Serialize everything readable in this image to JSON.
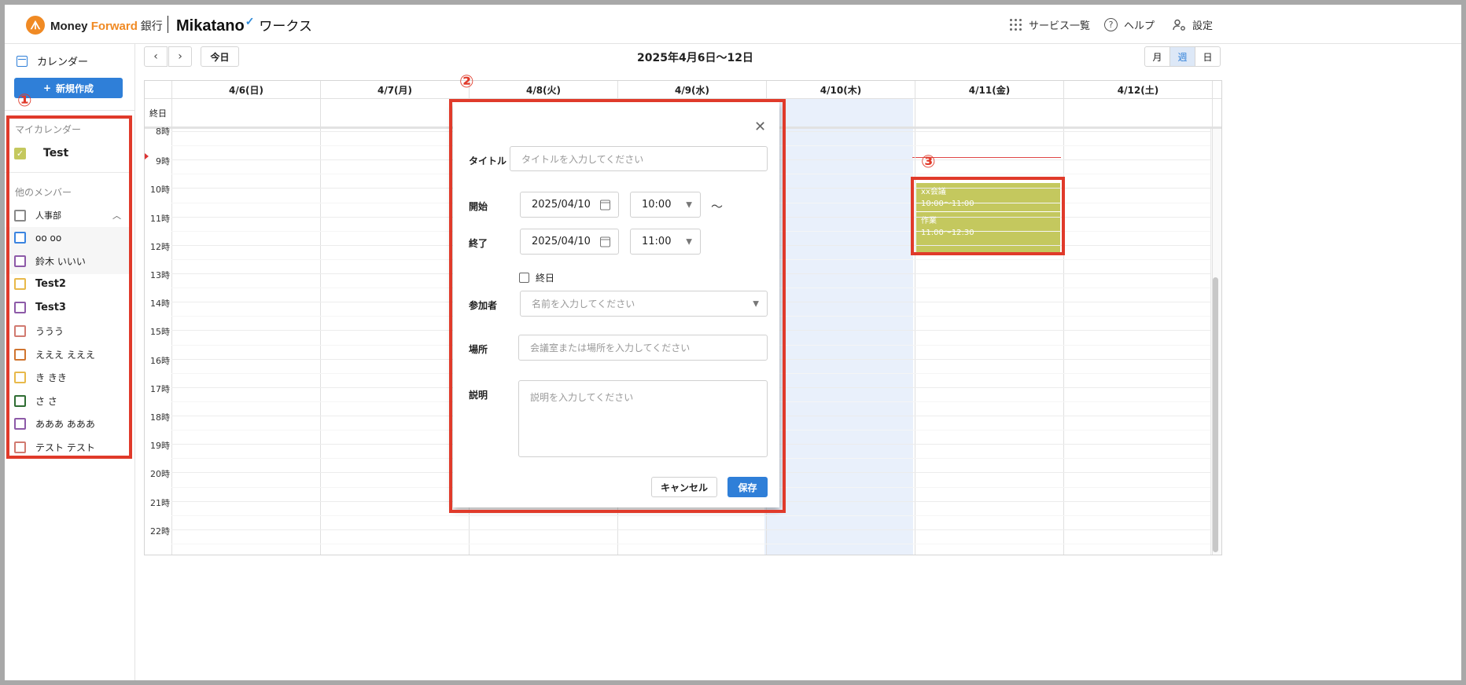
{
  "header": {
    "brand_money": "Money ",
    "brand_forward": "Forward",
    "brand_bank": " 銀行",
    "product": "Mikatano",
    "product_sub": "ワークス",
    "services_label": "サービス一覧",
    "help_label": "ヘルプ",
    "settings_label": "設定"
  },
  "sidebar": {
    "calendar_label": "カレンダー",
    "new_button": "新規作成",
    "my_calendars_title": "マイカレンダー",
    "my_calendars": [
      {
        "label": "Test",
        "color": "#c4c85e",
        "checked": true
      }
    ],
    "other_members_title": "他のメンバー",
    "group_label": "人事部",
    "members": [
      {
        "label": "oo oo",
        "color": "#3a84e0"
      },
      {
        "label": "鈴木 いいい",
        "color": "#8d5aa8"
      },
      {
        "label": "Test2",
        "color": "#e8b94a"
      },
      {
        "label": "Test3",
        "color": "#8d5aa8"
      },
      {
        "label": "ううう",
        "color": "#d17a70"
      },
      {
        "label": "えええ えええ",
        "color": "#d07530"
      },
      {
        "label": "き きき",
        "color": "#e8b94a"
      },
      {
        "label": "さ さ",
        "color": "#2f6d33"
      },
      {
        "label": "あああ あああ",
        "color": "#8d5aa8"
      },
      {
        "label": "テスト テスト",
        "color": "#d17a70"
      }
    ]
  },
  "toolbar": {
    "prev": "‹",
    "next": "›",
    "today": "今日",
    "range_title": "2025年4月6日〜12日",
    "views": [
      "月",
      "週",
      "日"
    ],
    "active_view": "週"
  },
  "calendar": {
    "allday_label": "終日",
    "days": [
      "4/6(日)",
      "4/7(月)",
      "4/8(火)",
      "4/9(水)",
      "4/10(木)",
      "4/11(金)",
      "4/12(土)"
    ],
    "hours": [
      "8時",
      "9時",
      "10時",
      "11時",
      "12時",
      "13時",
      "14時",
      "15時",
      "16時",
      "17時",
      "18時",
      "19時",
      "20時",
      "21時",
      "22時"
    ],
    "events": [
      {
        "title": "xx会議",
        "time": "10:00〜11:00",
        "day": "4/11(金)"
      },
      {
        "title": "作業",
        "time": "11:00〜12:30",
        "day": "4/11(金)"
      }
    ]
  },
  "modal": {
    "title_label": "タイトル",
    "title_placeholder": "タイトルを入力してください",
    "start_label": "開始",
    "start_date": "2025/04/10",
    "start_time": "10:00",
    "tilde": "〜",
    "end_label": "終了",
    "end_date": "2025/04/10",
    "end_time": "11:00",
    "allday_label": "終日",
    "participants_label": "参加者",
    "participants_placeholder": "名前を入力してください",
    "location_label": "場所",
    "location_placeholder": "会議室または場所を入力してください",
    "description_label": "説明",
    "description_placeholder": "説明を入力してください",
    "cancel_button": "キャンセル",
    "save_button": "保存"
  },
  "annotations": {
    "one": "①",
    "two": "②",
    "three": "③",
    "color": "#e03a2a"
  }
}
